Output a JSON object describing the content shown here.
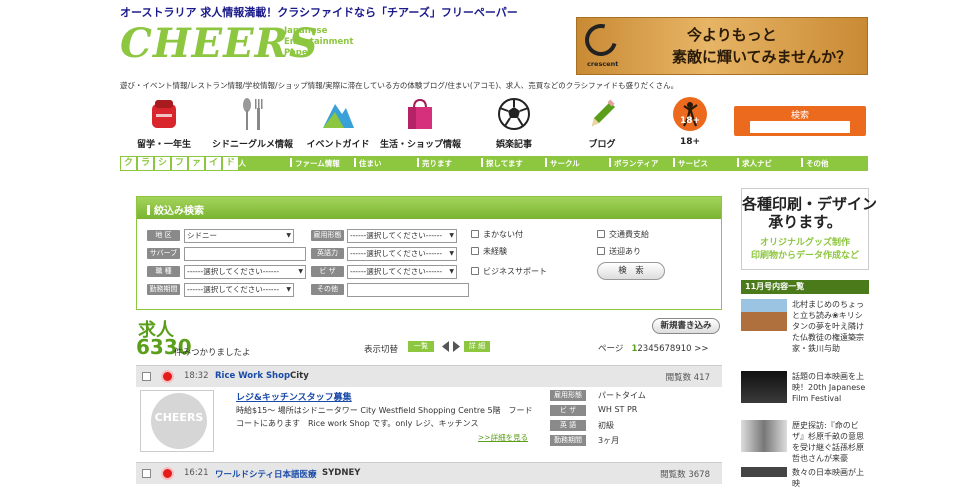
{
  "header": {
    "tagline": "オーストラリア 求人情報満載！クラシファイドなら「チアーズ」フリーペーパー",
    "logo_main": "CHEERS",
    "logo_sub": "Japanese\nEntertainment\nPaper",
    "banner": {
      "brand": "crescent",
      "line1": "今よりもっと",
      "line2": "素敵に輝いてみませんか？"
    },
    "description": "遊び・イベント情報/レストラン情報/学校情報/ショップ情報/実際に滞在している方の体験ブログ/住まい(アコモ)、求人、売買などのクラシファイドも盛りだくさん。"
  },
  "nav": [
    {
      "label": "留学・一年生",
      "icon": "school-bag-icon",
      "color": "#d9262c"
    },
    {
      "label": "シドニーグルメ情報",
      "icon": "cutlery-icon",
      "color": "#888888"
    },
    {
      "label": "イベントガイド",
      "icon": "mountain-icon",
      "color": "#3aa0d8"
    },
    {
      "label": "生活・ショップ情報",
      "icon": "shopping-bag-icon",
      "color": "#d62f7c"
    },
    {
      "label": "娯楽記事",
      "icon": "soccer-ball-icon",
      "color": "#222222"
    },
    {
      "label": "ブログ",
      "icon": "pencil-icon",
      "color": "#5a9e1a"
    },
    {
      "label": "18+",
      "icon": "dancer-icon",
      "color": "#ec6a1e"
    }
  ],
  "search": {
    "label": "検索"
  },
  "category_bar": {
    "classified": [
      "ク",
      "ラ",
      "シ",
      "フ",
      "ァ",
      "イ",
      "ド"
    ],
    "items": [
      "求人",
      "ファーム情報",
      "住まい",
      "売ります",
      "探してます",
      "サークル",
      "ボランティア",
      "サービス",
      "求人ナビ",
      "その他"
    ]
  },
  "filter": {
    "title": "絞込み検索",
    "labels": {
      "area": "地 区",
      "suburb": "サバーブ",
      "job_type": "職 種",
      "term": "勤務期間",
      "employment": "雇用形態",
      "english": "英語力",
      "visa": "ビ ザ",
      "other": "その他"
    },
    "area_value": "シドニー",
    "placeholder": "------選択してください------",
    "checks": [
      "まかない付",
      "未経験",
      "ビジネスサポート",
      "交通費支給",
      "送迎あり"
    ],
    "search_button": "検　索"
  },
  "results": {
    "title": "求人",
    "count": "6330",
    "count_suffix": "件みつかりましたよ",
    "view_label": "表示切替",
    "view_list": "一覧",
    "view_detail": "詳 細",
    "new_post": "新規書き込み",
    "pager_label": "ページ",
    "pages": [
      "1",
      "2",
      "3",
      "4",
      "5",
      "6",
      "7",
      "8",
      "9",
      "10",
      ">>"
    ]
  },
  "listings": [
    {
      "time": "18:32",
      "company": "Rice Work Shop",
      "city": "City",
      "views": "閲覧数 417",
      "title": "レジ&キッチンスタッフ募集",
      "desc": "時給$15～ 場所はシドニータワー City Westfield Shopping Centre 5階　フードコートにあります　Rice work Shop です。only レジ、キッチンス",
      "more": ">>詳細を見る",
      "thumb": "CHEERS",
      "details": [
        {
          "label": "雇用形態",
          "value": "パートタイム"
        },
        {
          "label": "ビ ザ",
          "value": "WH ST PR"
        },
        {
          "label": "英 語",
          "value": "初級"
        },
        {
          "label": "勤務期間",
          "value": "3ヶ月"
        }
      ]
    },
    {
      "time": "16:21",
      "company": "ワールドシティ日本語医療",
      "city": "SYDNEY",
      "views": "閲覧数 3678"
    }
  ],
  "sidebar": {
    "ad_main": "各種印刷・デザイン\n承ります。",
    "ad_sub": "オリジナルグッズ制作\n印刷物からデータ作成など",
    "list_title": "11月号内容一覧",
    "items": [
      {
        "text": "北村まじめのちょっと立ち読み❀キリシタンの夢を叶え隣けた仏教徒の権遠築宗家・鉄川与助"
      },
      {
        "text": "話題の日本映画を上映！20th Japanese Film Festival"
      },
      {
        "text": "歴史探訪:『命のビザ』杉原千畝の意思を受け継ぐ話孫杉原哲也さんが来豪"
      },
      {
        "text": "数々の日本映画が上映"
      }
    ]
  }
}
